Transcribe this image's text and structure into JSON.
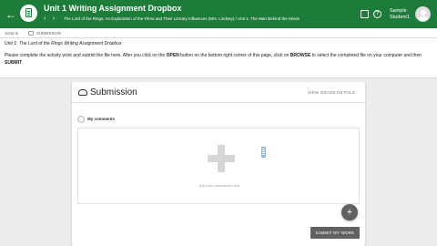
{
  "header": {
    "title": "Unit 1 Writing Assignment Dropbox",
    "breadcrumb": "The Lord of the Rings: An Exploration of the Films and Their Literary Influences (Mrs. Lindsey) / Unit 1: The Man Behind the Movie",
    "prev_glyph": "‹",
    "next_glyph": "›",
    "back_glyph": "←",
    "help_glyph": "?",
    "user_first": "Sample",
    "user_last": "Student1",
    "accent": "#1e7c3a"
  },
  "tabs": {
    "first": "Jump to",
    "third": "SUBMISSION"
  },
  "instructions": {
    "unit_prefix": "Unit 1:",
    "unit_title": "The Lord of the Rings Writing Assignment Dropbox",
    "p1": "Please complete the activity work and submit the file here. After you click on the ",
    "open": "OPEN",
    "p2": " button on the bottom right corner of this page, click on ",
    "browse": "BROWSE",
    "p3": " to select the completed file on your computer and then ",
    "submit": "SUBMIT",
    "p4": "."
  },
  "submission": {
    "title": "Submission",
    "view_grade": "VIEW GRADE DETAILS",
    "comments_label": "My comments",
    "add_hint": "Add your comments here",
    "fab_glyph": "+",
    "submit_label": "SUBMIT MY WORK"
  },
  "icons": [
    "back-arrow-icon",
    "app-logo-icon",
    "prev-icon",
    "next-icon",
    "message-icon",
    "help-icon",
    "avatar",
    "cloud-upload-icon",
    "plus-icon",
    "file-icon"
  ]
}
